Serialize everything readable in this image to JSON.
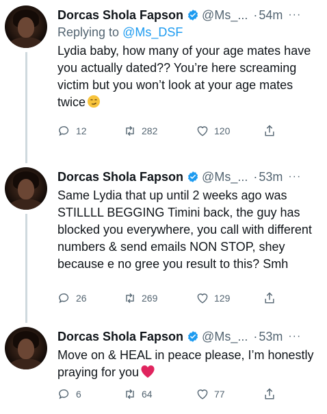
{
  "tweets": [
    {
      "name": "Dorcas Shola Fapson",
      "handle": "@Ms_...",
      "separator": "·",
      "time": "54m",
      "more": "···",
      "reply_prefix": "Replying to ",
      "reply_handle": "@Ms_DSF",
      "text": "Lydia baby, how many of your age mates have you actually dated?? You’re here screaming victim but you won’t look at your age mates twice",
      "emoji": "smirking-face",
      "replies": "12",
      "retweets": "282",
      "likes": "120"
    },
    {
      "name": "Dorcas Shola Fapson",
      "handle": "@Ms_...",
      "separator": "·",
      "time": "53m",
      "more": "···",
      "text": "Same Lydia that up until 2 weeks ago was STILLLL BEGGING Timini back, the guy has blocked you everywhere, you call with different numbers & send emails NON STOP, shey because e no gree you result to this? Smh",
      "replies": "26",
      "retweets": "269",
      "likes": "129"
    },
    {
      "name": "Dorcas Shola Fapson",
      "handle": "@Ms_...",
      "separator": "·",
      "time": "53m",
      "more": "···",
      "text": "Move on & HEAL in peace please, I’m honestly praying for you",
      "emoji": "red-heart",
      "replies": "6",
      "retweets": "64",
      "likes": "77"
    }
  ],
  "colors": {
    "verified": "#1d9bf0",
    "link": "#1d9bf0",
    "muted": "#536471",
    "thread_line": "#cfd9de"
  }
}
